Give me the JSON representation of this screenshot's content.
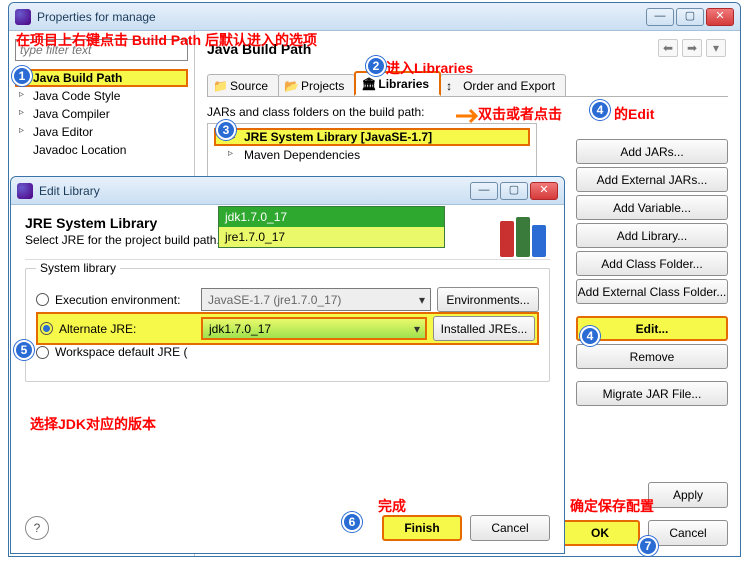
{
  "annotations": {
    "a1": "在项目上右键点击 Build Path 后默认进入的选项",
    "a2": "进入Libraries",
    "a3": "双击或者点击",
    "a3b": "的Edit",
    "a5": "选择JDK对应的版本",
    "a6": "完成",
    "a7": "确定保存配置"
  },
  "propWindow": {
    "title": "Properties for manage",
    "filterPlaceholder": "type filter text",
    "treeItems": [
      "Java Build Path",
      "Java Code Style",
      "Java Compiler",
      "Java Editor",
      "Javadoc Location"
    ],
    "sectionTitle": "Java Build Path",
    "tabs": [
      "Source",
      "Projects",
      "Libraries",
      "Order and Export"
    ],
    "subLabel": "JARs and class folders on the build path:",
    "libRows": [
      "JRE System Library [JavaSE-1.7]",
      "Maven Dependencies"
    ],
    "sideButtons": [
      "Add JARs...",
      "Add External JARs...",
      "Add Variable...",
      "Add Library...",
      "Add Class Folder...",
      "Add External Class Folder...",
      "Edit...",
      "Remove",
      "Migrate JAR File..."
    ],
    "apply": "Apply",
    "ok": "OK",
    "cancel": "Cancel"
  },
  "editDialog": {
    "title": "Edit Library",
    "heading": "JRE System Library",
    "sub": "Select JRE for the project build path.",
    "group": "System library",
    "execEnvLabel": "Execution environment:",
    "execEnvValue": "JavaSE-1.7 (jre1.7.0_17)",
    "envBtn": "Environments...",
    "altLabel": "Alternate JRE:",
    "altValue": "jdk1.7.0_17",
    "installedBtn": "Installed JREs...",
    "wsDefaultLabel": "Workspace default JRE (",
    "dropdown": [
      "jdk1.7.0_17",
      "jre1.7.0_17"
    ],
    "finish": "Finish",
    "cancel": "Cancel"
  }
}
